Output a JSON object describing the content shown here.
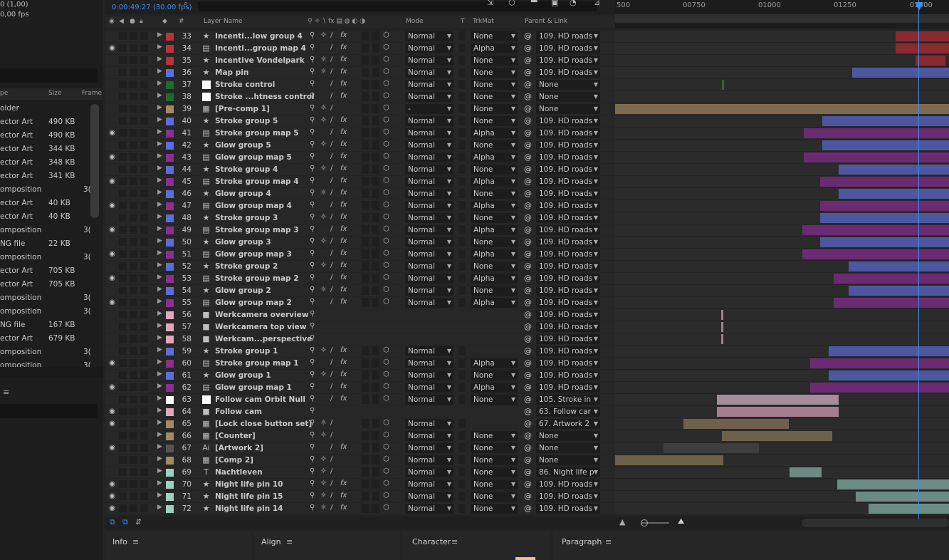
{
  "project": {
    "top_lines": [
      "0 (1,00)",
      "0,00 fps"
    ],
    "columns": {
      "type": "pe",
      "size": "Size",
      "frame": "Frame"
    },
    "items": [
      {
        "type": "older",
        "size": "",
        "frame": ""
      },
      {
        "type": "ector Art",
        "size": "490 KB",
        "frame": ""
      },
      {
        "type": "ector Art",
        "size": "490 KB",
        "frame": ""
      },
      {
        "type": "ector Art",
        "size": "344 KB",
        "frame": ""
      },
      {
        "type": "ector Art",
        "size": "348 KB",
        "frame": ""
      },
      {
        "type": "ector Art",
        "size": "341 KB",
        "frame": ""
      },
      {
        "type": "omposition",
        "size": "",
        "frame": "3("
      },
      {
        "type": "ector Art",
        "size": "40 KB",
        "frame": ""
      },
      {
        "type": "ector Art",
        "size": "40 KB",
        "frame": ""
      },
      {
        "type": "omposition",
        "size": "",
        "frame": "3("
      },
      {
        "type": "NG file",
        "size": "22 KB",
        "frame": ""
      },
      {
        "type": "omposition",
        "size": "",
        "frame": "3("
      },
      {
        "type": "ector Art",
        "size": "705 KB",
        "frame": ""
      },
      {
        "type": "ector Art",
        "size": "705 KB",
        "frame": ""
      },
      {
        "type": "omposition",
        "size": "",
        "frame": "3("
      },
      {
        "type": "omposition",
        "size": "",
        "frame": "3("
      },
      {
        "type": "NG file",
        "size": "167 KB",
        "frame": ""
      },
      {
        "type": "ector Art",
        "size": "679 KB",
        "frame": ""
      },
      {
        "type": "omposition",
        "size": "",
        "frame": "3("
      },
      {
        "type": "omposition",
        "size": "",
        "frame": "3("
      }
    ]
  },
  "timeline": {
    "current_time": "0:00:49:27 (30.00 fps)",
    "columns": {
      "layer_name": "Layer Name",
      "mode": "Mode",
      "t": "T",
      "trkmat": "TrkMat",
      "parent": "Parent & Link"
    },
    "ruler_ticks": [
      "500",
      "00750",
      "01000",
      "01250",
      "01500"
    ],
    "colors": {
      "red": "#b5353b",
      "blue": "#5b6ed6",
      "green": "#1f6b2a",
      "white": "#ffffff",
      "tan": "#a48a64",
      "purple": "#8a2f8f",
      "pink": "#e3a7bd",
      "gray": "#555555",
      "sea": "#9fcfc0"
    },
    "layers": [
      {
        "num": "33",
        "name": "Incenti...low group 4",
        "color": "red",
        "icon": "star",
        "eye": false,
        "mode": "Normal",
        "trkmat": "None",
        "parent": "109. HD roads",
        "bar": {
          "s": 0.84,
          "e": 1.0,
          "c": "#8a2a30"
        }
      },
      {
        "num": "34",
        "name": "Incenti...group map 4",
        "color": "red",
        "icon": "doc",
        "eye": true,
        "mode": "Normal",
        "trkmat": "Alpha",
        "parent": "109. HD roads",
        "bar": {
          "s": 0.84,
          "e": 1.0,
          "c": "#8a2a30"
        }
      },
      {
        "num": "35",
        "name": "Incentive Vondelpark",
        "color": "red",
        "icon": "star",
        "eye": false,
        "mode": "Normal",
        "trkmat": "None",
        "parent": "109. HD roads",
        "bar": {
          "s": 0.9,
          "e": 0.99,
          "c": "#8a2a30"
        }
      },
      {
        "num": "36",
        "name": "Map pin",
        "color": "blue",
        "icon": "star",
        "eye": false,
        "mode": "Normal",
        "trkmat": "None",
        "parent": "109. HD roads",
        "bar": {
          "s": 0.71,
          "e": 1.0,
          "c": "#4c579f"
        }
      },
      {
        "num": "37",
        "name": "Stroke control",
        "color": "green",
        "icon": "white",
        "eye": false,
        "mode": "Normal",
        "trkmat": "None",
        "parent": "None",
        "bar": {
          "s": 0.32,
          "e": 0.325,
          "c": "#2b6b33"
        }
      },
      {
        "num": "38",
        "name": "Stroke ...htness control",
        "color": "green",
        "icon": "white",
        "eye": false,
        "mode": "Normal",
        "trkmat": "None",
        "parent": "None",
        "bar": null
      },
      {
        "num": "39",
        "name": "[Pre-comp 1]",
        "color": "tan",
        "icon": "comp",
        "eye": false,
        "mode": "-",
        "trkmat": "None",
        "parent": "None",
        "bar": {
          "s": 0.0,
          "e": 1.0,
          "c": "#7d6a4f"
        }
      },
      {
        "num": "40",
        "name": "Stroke group 5",
        "color": "blue",
        "icon": "star",
        "eye": false,
        "mode": "Normal",
        "trkmat": "None",
        "parent": "109. HD roads",
        "bar": {
          "s": 0.62,
          "e": 1.0,
          "c": "#4c579f"
        }
      },
      {
        "num": "41",
        "name": "Stroke group map 5",
        "color": "purple",
        "icon": "doc",
        "eye": true,
        "mode": "Normal",
        "trkmat": "Alpha",
        "parent": "109. HD roads",
        "bar": {
          "s": 0.565,
          "e": 1.0,
          "c": "#6b2a72"
        }
      },
      {
        "num": "42",
        "name": "Glow group 5",
        "color": "blue",
        "icon": "star",
        "eye": false,
        "mode": "Normal",
        "trkmat": "None",
        "parent": "109. HD roads",
        "bar": {
          "s": 0.62,
          "e": 1.0,
          "c": "#4c579f"
        }
      },
      {
        "num": "43",
        "name": "Glow group map 5",
        "color": "purple",
        "icon": "doc",
        "eye": true,
        "mode": "Normal",
        "trkmat": "Alpha",
        "parent": "109. HD roads",
        "bar": {
          "s": 0.565,
          "e": 1.0,
          "c": "#6b2a72"
        }
      },
      {
        "num": "44",
        "name": "Stroke group 4",
        "color": "blue",
        "icon": "star",
        "eye": false,
        "mode": "Normal",
        "trkmat": "None",
        "parent": "109. HD roads",
        "bar": {
          "s": 0.67,
          "e": 1.0,
          "c": "#4c579f"
        }
      },
      {
        "num": "45",
        "name": "Stroke group map 4",
        "color": "purple",
        "icon": "doc",
        "eye": true,
        "mode": "Normal",
        "trkmat": "Alpha",
        "parent": "109. HD roads",
        "bar": {
          "s": 0.615,
          "e": 1.0,
          "c": "#6b2a72"
        }
      },
      {
        "num": "46",
        "name": "Glow group 4",
        "color": "blue",
        "icon": "star",
        "eye": false,
        "mode": "Normal",
        "trkmat": "None",
        "parent": "109. HD roads",
        "bar": {
          "s": 0.67,
          "e": 1.0,
          "c": "#4c579f"
        }
      },
      {
        "num": "47",
        "name": "Glow group map 4",
        "color": "purple",
        "icon": "doc",
        "eye": true,
        "mode": "Normal",
        "trkmat": "Alpha",
        "parent": "109. HD roads",
        "bar": {
          "s": 0.615,
          "e": 1.0,
          "c": "#6b2a72"
        }
      },
      {
        "num": "48",
        "name": "Stroke group 3",
        "color": "blue",
        "icon": "star",
        "eye": false,
        "mode": "Normal",
        "trkmat": "None",
        "parent": "109. HD roads",
        "bar": {
          "s": 0.615,
          "e": 1.0,
          "c": "#4c579f"
        }
      },
      {
        "num": "49",
        "name": "Stroke group map 3",
        "color": "purple",
        "icon": "doc",
        "eye": true,
        "mode": "Normal",
        "trkmat": "Alpha",
        "parent": "109. HD roads",
        "bar": {
          "s": 0.56,
          "e": 1.0,
          "c": "#6b2a72"
        }
      },
      {
        "num": "50",
        "name": "Glow group 3",
        "color": "blue",
        "icon": "star",
        "eye": false,
        "mode": "Normal",
        "trkmat": "None",
        "parent": "109. HD roads",
        "bar": {
          "s": 0.615,
          "e": 1.0,
          "c": "#4c579f"
        }
      },
      {
        "num": "51",
        "name": "Glow group map 3",
        "color": "purple",
        "icon": "doc",
        "eye": true,
        "mode": "Normal",
        "trkmat": "Alpha",
        "parent": "109. HD roads",
        "bar": {
          "s": 0.56,
          "e": 1.0,
          "c": "#6b2a72"
        }
      },
      {
        "num": "52",
        "name": "Stroke group 2",
        "color": "blue",
        "icon": "star",
        "eye": false,
        "mode": "Normal",
        "trkmat": "None",
        "parent": "109. HD roads",
        "bar": {
          "s": 0.7,
          "e": 1.0,
          "c": "#4c579f"
        }
      },
      {
        "num": "53",
        "name": "Stroke group map 2",
        "color": "purple",
        "icon": "doc",
        "eye": true,
        "mode": "Normal",
        "trkmat": "Alpha",
        "parent": "109. HD roads",
        "bar": {
          "s": 0.655,
          "e": 1.0,
          "c": "#6b2a72"
        }
      },
      {
        "num": "54",
        "name": "Glow group 2",
        "color": "blue",
        "icon": "star",
        "eye": false,
        "mode": "Normal",
        "trkmat": "None",
        "parent": "109. HD roads",
        "bar": {
          "s": 0.7,
          "e": 1.0,
          "c": "#4c579f"
        }
      },
      {
        "num": "55",
        "name": "Glow group map 2",
        "color": "purple",
        "icon": "doc",
        "eye": true,
        "mode": "Normal",
        "trkmat": "Alpha",
        "parent": "109. HD roads",
        "bar": {
          "s": 0.655,
          "e": 1.0,
          "c": "#6b2a72"
        }
      },
      {
        "num": "56",
        "name": "Werkcamera overview",
        "color": "pink",
        "icon": "cam",
        "eye": false,
        "mode": "",
        "trkmat": "",
        "parent": "109. HD roads",
        "bar": {
          "s": 0.318,
          "e": 0.325,
          "c": "#a57d8d"
        }
      },
      {
        "num": "57",
        "name": "Werkcamera top view",
        "color": "pink",
        "icon": "cam",
        "eye": false,
        "mode": "",
        "trkmat": "",
        "parent": "109. HD roads",
        "bar": {
          "s": 0.318,
          "e": 0.325,
          "c": "#a57d8d"
        }
      },
      {
        "num": "58",
        "name": "Werkcam...perspective",
        "color": "pink",
        "icon": "cam",
        "eye": false,
        "mode": "",
        "trkmat": "",
        "parent": "109. HD roads",
        "bar": {
          "s": 0.318,
          "e": 0.325,
          "c": "#a57d8d"
        }
      },
      {
        "num": "59",
        "name": "Stroke group 1",
        "color": "blue",
        "icon": "star",
        "eye": false,
        "mode": "Normal",
        "trkmat": "",
        "parent": "109. HD roads",
        "bar": {
          "s": 0.64,
          "e": 1.0,
          "c": "#4c579f"
        }
      },
      {
        "num": "60",
        "name": "Stroke group map 1",
        "color": "purple",
        "icon": "doc",
        "eye": true,
        "mode": "Normal",
        "trkmat": "Alpha",
        "parent": "109. HD roads",
        "bar": {
          "s": 0.585,
          "e": 1.0,
          "c": "#6b2a72"
        }
      },
      {
        "num": "61",
        "name": "Glow group 1",
        "color": "blue",
        "icon": "star",
        "eye": false,
        "mode": "Normal",
        "trkmat": "None",
        "parent": "109. HD roads",
        "bar": {
          "s": 0.64,
          "e": 1.0,
          "c": "#4c579f"
        }
      },
      {
        "num": "62",
        "name": "Glow group map 1",
        "color": "purple",
        "icon": "doc",
        "eye": true,
        "mode": "Normal",
        "trkmat": "Alpha",
        "parent": "109. HD roads",
        "bar": {
          "s": 0.585,
          "e": 1.0,
          "c": "#6b2a72"
        }
      },
      {
        "num": "63",
        "name": "Follow cam Orbit Null",
        "color": "white",
        "icon": "white",
        "eye": false,
        "mode": "Normal",
        "trkmat": "None",
        "parent": "105. Stroke in",
        "bar": {
          "s": 0.305,
          "e": 0.67,
          "c": "#a58d99"
        }
      },
      {
        "num": "64",
        "name": "Follow cam",
        "color": "pink",
        "icon": "cam",
        "eye": true,
        "mode": "",
        "trkmat": "",
        "parent": "63. Follow car",
        "bar": {
          "s": 0.305,
          "e": 0.67,
          "c": "#a57d8d"
        }
      },
      {
        "num": "65",
        "name": "[Lock close button set]",
        "color": "tan",
        "icon": "comp",
        "eye": true,
        "mode": "Normal",
        "trkmat": "",
        "parent": "67. Artwork 2",
        "bar": {
          "s": 0.205,
          "e": 0.52,
          "c": "#6e604a"
        }
      },
      {
        "num": "66",
        "name": "[Counter]",
        "color": "tan",
        "icon": "comp",
        "eye": false,
        "mode": "Normal",
        "trkmat": "None",
        "parent": "None",
        "bar": {
          "s": 0.32,
          "e": 0.65,
          "c": "#6e604a"
        }
      },
      {
        "num": "67",
        "name": "[Artwork 2]",
        "color": "gray",
        "icon": "ai",
        "eye": true,
        "mode": "Normal",
        "trkmat": "None",
        "parent": "None",
        "bar": {
          "s": 0.145,
          "e": 0.43,
          "c": "#3e3e3e"
        }
      },
      {
        "num": "68",
        "name": "[Comp 2]",
        "color": "tan",
        "icon": "comp",
        "eye": false,
        "mode": "Normal",
        "trkmat": "None",
        "parent": "None",
        "bar": {
          "s": 0.0,
          "e": 0.325,
          "c": "#6e604a"
        }
      },
      {
        "num": "69",
        "name": "Nachtleven",
        "color": "sea",
        "icon": "text",
        "eye": false,
        "mode": "Normal",
        "trkmat": "None",
        "parent": "86. Night life p",
        "bar": {
          "s": 0.522,
          "e": 0.618,
          "c": "#6c8b82"
        }
      },
      {
        "num": "70",
        "name": "Night life pin 10",
        "color": "sea",
        "icon": "star",
        "eye": true,
        "mode": "Normal",
        "trkmat": "None",
        "parent": "109. HD roads",
        "bar": {
          "s": 0.665,
          "e": 1.0,
          "c": "#6c8b82"
        }
      },
      {
        "num": "71",
        "name": "Night life pin 15",
        "color": "sea",
        "icon": "star",
        "eye": true,
        "mode": "Normal",
        "trkmat": "None",
        "parent": "109. HD roads",
        "bar": {
          "s": 0.72,
          "e": 1.0,
          "c": "#6c8b82"
        }
      },
      {
        "num": "72",
        "name": "Night life pin 14",
        "color": "sea",
        "icon": "star",
        "eye": true,
        "mode": "Normal",
        "trkmat": "None",
        "parent": "109. HD roads",
        "bar": {
          "s": 0.76,
          "e": 1.0,
          "c": "#6c8b82"
        }
      }
    ]
  },
  "panels": {
    "info": "Info",
    "align": "Align",
    "character": "Character",
    "paragraph": "Paragraph",
    "menu_glyph": "≡"
  }
}
